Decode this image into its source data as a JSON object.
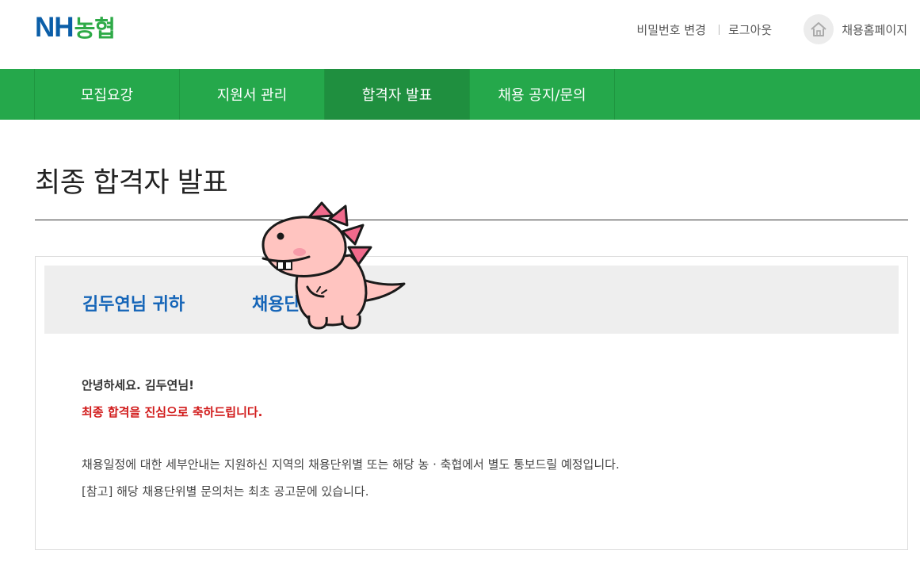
{
  "header": {
    "logo_nh": "NH",
    "logo_ko": "농협",
    "change_password": "비밀번호 변경",
    "logout": "로그아웃",
    "recruit_home": "채용홈페이지",
    "home_icon": "house-icon"
  },
  "nav": {
    "tabs": [
      {
        "label": "모집요강"
      },
      {
        "label": "지원서 관리"
      },
      {
        "label": "합격자 발표",
        "active": true
      },
      {
        "label": "채용 공지/문의"
      }
    ]
  },
  "page": {
    "title": "최종 합격자 발표"
  },
  "result": {
    "name_heading": "김두연님 귀하",
    "unit_heading": "채용단",
    "greeting": "안녕하세요. 김두연님!",
    "congrats": "최종 합격을 진심으로 축하드립니다.",
    "info_line1": "채용일정에 대한 세부안내는 지원하신 지역의 채용단위별 또는 해당 농 · 축협에서 별도 통보드릴 예정입니다.",
    "info_line2": "[참고] 해당 채용단위별 문의처는 최초 공고문에 있습니다."
  },
  "colors": {
    "nav_green": "#25a84b",
    "nav_active": "#1f8f3f",
    "heading_blue": "#1565b8",
    "congrats_red": "#d11a1a",
    "logo_blue": "#0b5ea8",
    "logo_green": "#2eaa47"
  }
}
